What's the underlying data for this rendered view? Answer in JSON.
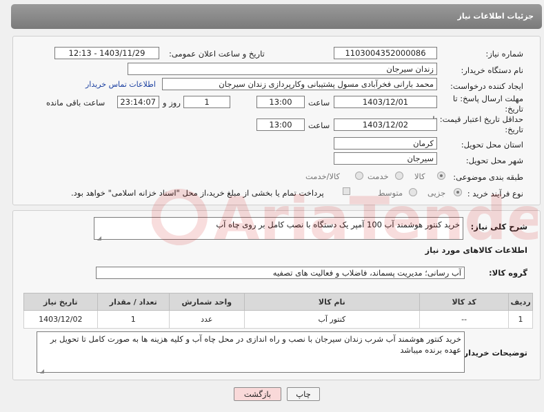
{
  "header": {
    "title": "جزئیات اطلاعات نیاز"
  },
  "form": {
    "need_number_label": "شماره نیاز:",
    "need_number": "1103004352000086",
    "announce_label": "تاریخ و ساعت اعلان عمومی:",
    "announce_value": "1403/11/29 - 12:13",
    "buyer_org_label": "نام دستگاه خریدار:",
    "buyer_org": "زندان سیرجان",
    "creator_label": "ایجاد کننده درخواست:",
    "creator": "محمد بارانی فخرآبادی مسول پشتیبانی وکارپردازی زندان سیرجان",
    "contact_link": "اطلاعات تماس خریدار",
    "deadline_label_1": "مهلت ارسال پاسخ: تا",
    "deadline_label_2": "تاریخ:",
    "deadline_date": "1403/12/01",
    "time_label": "ساعت",
    "deadline_time": "13:00",
    "days_value": "1",
    "days_label": "روز و",
    "remaining_time": "23:14:07",
    "remaining_label": "ساعت باقی مانده",
    "validity_label_1": "حداقل تاریخ اعتبار قیمت: تا",
    "validity_label_2": "تاریخ:",
    "validity_date": "1403/12/02",
    "validity_time": "13:00",
    "province_label": "استان محل تحویل:",
    "province": "کرمان",
    "city_label": "شهر محل تحویل:",
    "city": "سیرجان",
    "category_label": "طبقه بندی موضوعی:",
    "category_options": [
      "کالا",
      "خدمت",
      "کالا/خدمت"
    ],
    "process_label": "نوع فرآیند خرید :",
    "process_options": [
      "جزیی",
      "متوسط"
    ],
    "payment_note": "پرداخت تمام یا بخشی از مبلغ خرید،از محل \"اسناد خزانه اسلامی\" خواهد بود."
  },
  "summary": {
    "label": "شرح کلی نیاز:",
    "value": "خرید کنتور هوشمند آب  100 آمپر یک دستگاه با نصب کامل بر روی چاه آب"
  },
  "goods_info_title": "اطلاعات کالاهای مورد نیاز",
  "goods_group": {
    "label": "گروه کالا:",
    "value": "آب رسانی؛ مدیریت پسماند، فاضلاب و فعالیت های تصفیه"
  },
  "table": {
    "headers": [
      "ردیف",
      "کد کالا",
      "نام کالا",
      "واحد شمارش",
      "تعداد / مقدار",
      "تاریخ نیاز"
    ],
    "rows": [
      [
        "1",
        "--",
        "کنتور آب",
        "عدد",
        "1",
        "1403/12/02"
      ]
    ]
  },
  "buyer_notes": {
    "label": "توضیحات خریدار:",
    "value": "خرید کنتور هوشمند آب شرب زندان سیرجان با نصب و راه اندازی در محل چاه آب  و کلیه هزینه ها به صورت کامل تا تحویل بر عهده برنده میباشد"
  },
  "buttons": {
    "print": "چاپ",
    "back": "بازگشت"
  },
  "colors": {
    "header": "#8a8a8a",
    "link": "#1a3fa0",
    "back_button": "#f9d9d9"
  }
}
